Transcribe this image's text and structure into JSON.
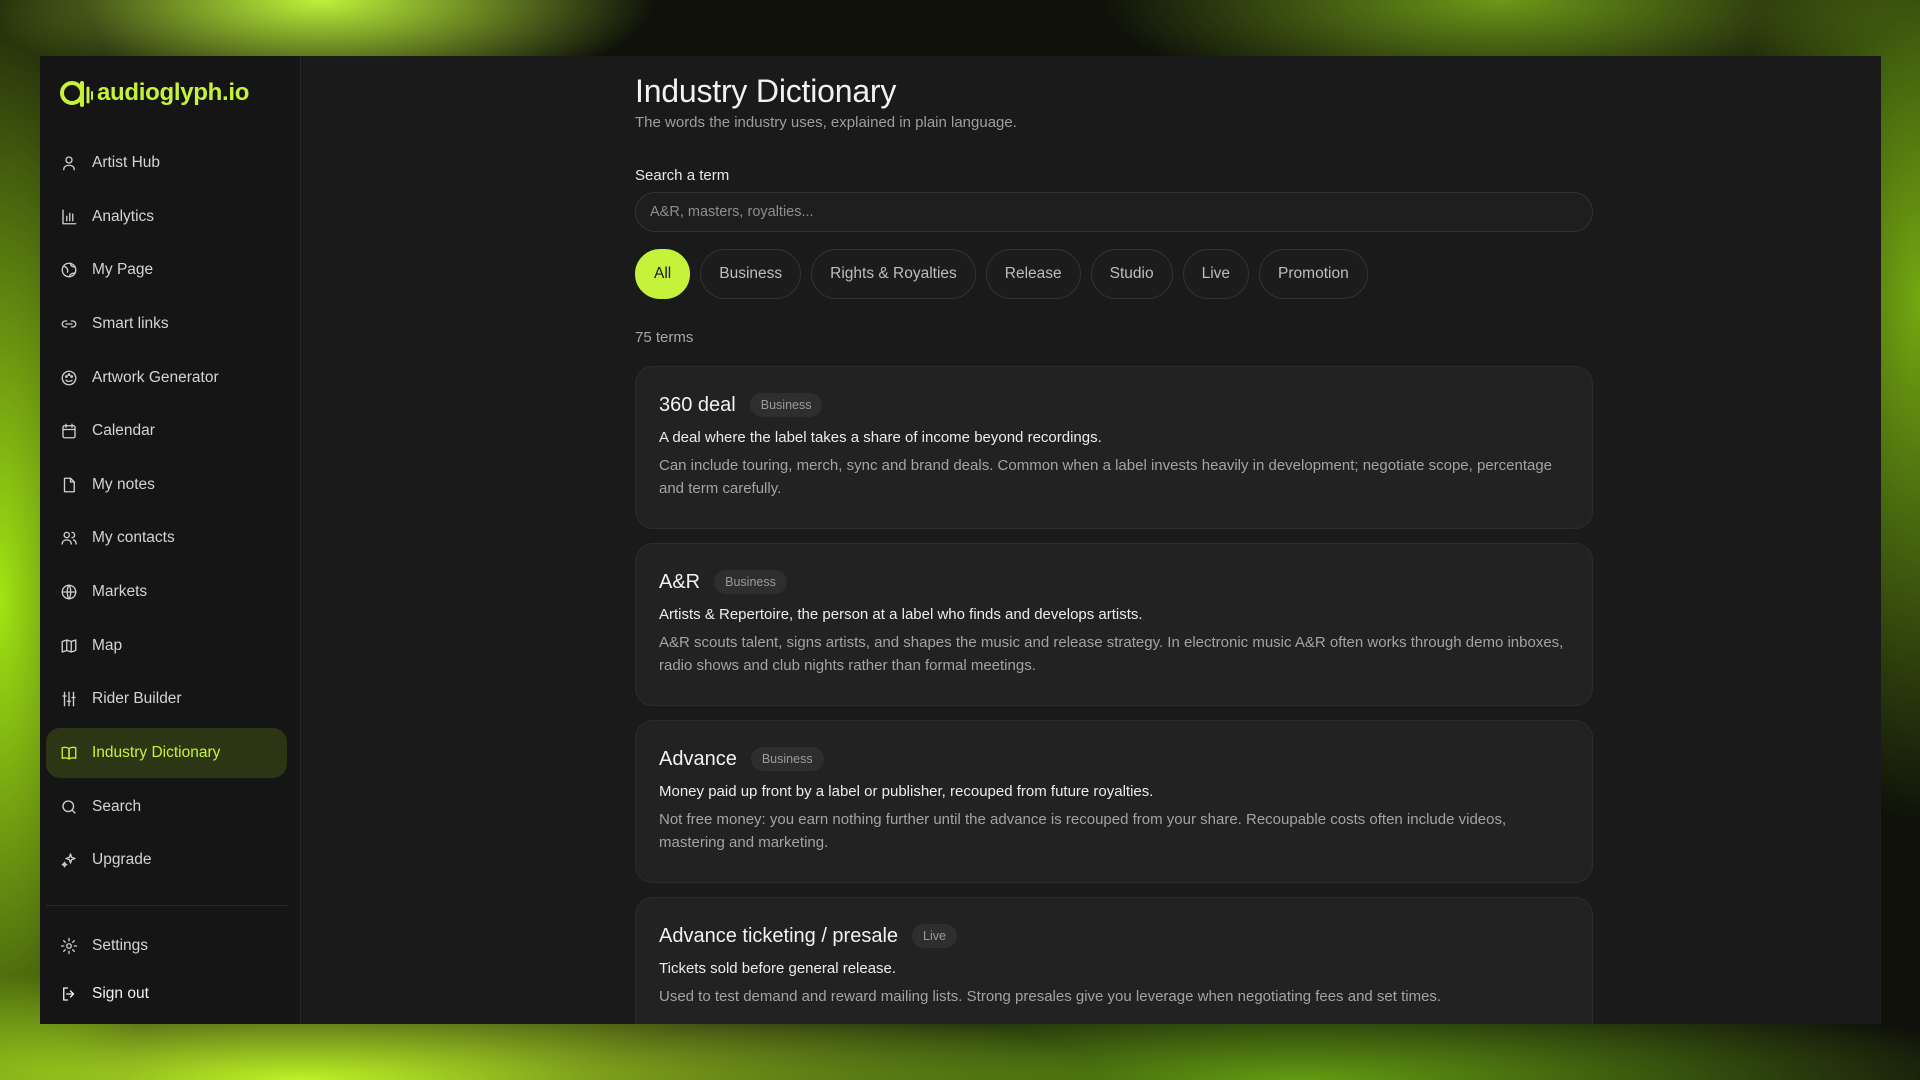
{
  "brand": {
    "name": "audioglyph.io",
    "accent": "#c6f33a"
  },
  "sidebar": {
    "items": [
      {
        "label": "Artist Hub",
        "icon": "user-icon"
      },
      {
        "label": "Analytics",
        "icon": "bar-chart-icon"
      },
      {
        "label": "My Page",
        "icon": "globe-icon"
      },
      {
        "label": "Smart links",
        "icon": "link-icon"
      },
      {
        "label": "Artwork Generator",
        "icon": "palette-icon"
      },
      {
        "label": "Calendar",
        "icon": "calendar-icon"
      },
      {
        "label": "My notes",
        "icon": "note-icon"
      },
      {
        "label": "My contacts",
        "icon": "users-icon"
      },
      {
        "label": "Markets",
        "icon": "world-icon"
      },
      {
        "label": "Map",
        "icon": "map-icon"
      },
      {
        "label": "Rider Builder",
        "icon": "sliders-icon"
      },
      {
        "label": "Industry Dictionary",
        "icon": "book-icon",
        "active": true
      },
      {
        "label": "Search",
        "icon": "search-icon"
      },
      {
        "label": "Upgrade",
        "icon": "sparkles-icon"
      }
    ],
    "bottom": [
      {
        "label": "Settings",
        "icon": "gear-icon"
      },
      {
        "label": "Sign out",
        "icon": "logout-icon"
      }
    ]
  },
  "page": {
    "title": "Industry Dictionary",
    "subtitle": "The words the industry uses, explained in plain language."
  },
  "search": {
    "label": "Search a term",
    "placeholder": "A&R, masters, royalties..."
  },
  "filters": [
    "All",
    "Business",
    "Rights & Royalties",
    "Release",
    "Studio",
    "Live",
    "Promotion"
  ],
  "active_filter": "All",
  "count_text": "75 terms",
  "terms": [
    {
      "term": "360 deal",
      "category": "Business",
      "short": "A deal where the label takes a share of income beyond recordings.",
      "long": "Can include touring, merch, sync and brand deals. Common when a label invests heavily in development; negotiate scope, percentage and term carefully."
    },
    {
      "term": "A&R",
      "category": "Business",
      "short": "Artists & Repertoire, the person at a label who finds and develops artists.",
      "long": "A&R scouts talent, signs artists, and shapes the music and release strategy. In electronic music A&R often works through demo inboxes, radio shows and club nights rather than formal meetings."
    },
    {
      "term": "Advance",
      "category": "Business",
      "short": "Money paid up front by a label or publisher, recouped from future royalties.",
      "long": "Not free money: you earn nothing further until the advance is recouped from your share. Recoupable costs often include videos, mastering and marketing."
    },
    {
      "term": "Advance ticketing / presale",
      "category": "Live",
      "short": "Tickets sold before general release.",
      "long": "Used to test demand and reward mailing lists. Strong presales give you leverage when negotiating fees and set times."
    }
  ]
}
